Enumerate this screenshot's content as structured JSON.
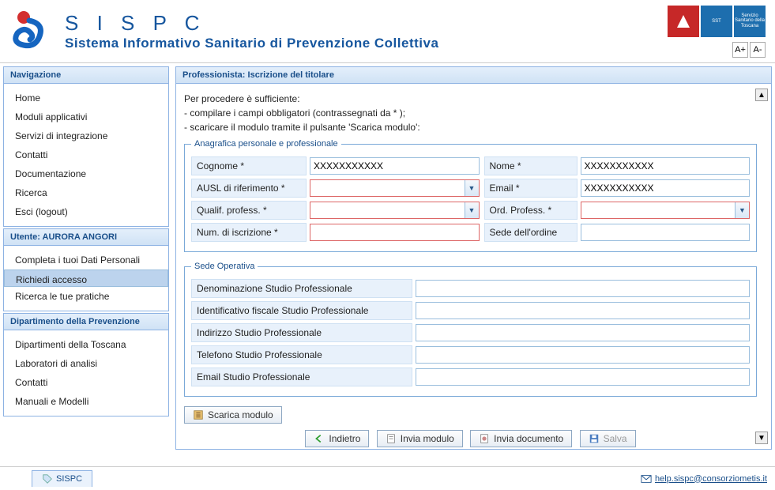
{
  "app": {
    "short": "S I S P C",
    "long": "Sistema Informativo Sanitario di Prevenzione Collettiva",
    "font_inc": "A+",
    "font_dec": "A-",
    "region_tip": "Servizio Sanitario della Toscana"
  },
  "nav": {
    "header": "Navigazione",
    "items": [
      "Home",
      "Moduli applicativi",
      "Servizi di integrazione",
      "Contatti",
      "Documentazione",
      "Ricerca",
      "Esci (logout)"
    ]
  },
  "user": {
    "header": "Utente: AURORA ANGORI",
    "items": [
      "Completa i tuoi Dati Personali",
      "Richiedi accesso",
      "Ricerca le tue pratiche"
    ],
    "selected_index": 1
  },
  "dept": {
    "header": "Dipartimento della Prevenzione",
    "items": [
      "Dipartimenti della Toscana",
      "Laboratori di analisi",
      "Contatti",
      "Manuali e Modelli"
    ]
  },
  "main": {
    "title": "Professionista: Iscrizione del titolare",
    "intro": {
      "l1": "Per procedere è sufficiente:",
      "l2": "- compilare i campi obbligatori (contrassegnati da * );",
      "l3": "- scaricare il modulo tramite il pulsante 'Scarica modulo':"
    },
    "fs1": {
      "legend": "Anagrafica personale e professionale",
      "cognome_l": "Cognome *",
      "cognome_v": "XXXXXXXXXXX",
      "nome_l": "Nome *",
      "nome_v": "XXXXXXXXXXX",
      "ausl_l": "AUSL di riferimento *",
      "ausl_v": "",
      "email_l": "Email *",
      "email_v": "XXXXXXXXXXX",
      "qual_l": "Qualif. profess. *",
      "qual_v": "",
      "ord_l": "Ord. Profess. *",
      "ord_v": "",
      "numisc_l": "Num. di iscrizione *",
      "numisc_v": "",
      "sede_l": "Sede dell'ordine",
      "sede_v": ""
    },
    "fs2": {
      "legend": "Sede Operativa",
      "den_l": "Denominazione Studio Professionale",
      "idf_l": "Identificativo fiscale Studio Professionale",
      "ind_l": "Indirizzo Studio Professionale",
      "tel_l": "Telefono Studio Professionale",
      "eml_l": "Email Studio Professionale"
    },
    "buttons": {
      "scarica": "Scarica modulo",
      "indietro": "Indietro",
      "invia_mod": "Invia modulo",
      "invia_doc": "Invia documento",
      "salva": "Salva"
    }
  },
  "footer": {
    "tab": "SISPC",
    "help": "help.sispc@consorziometis.it"
  }
}
